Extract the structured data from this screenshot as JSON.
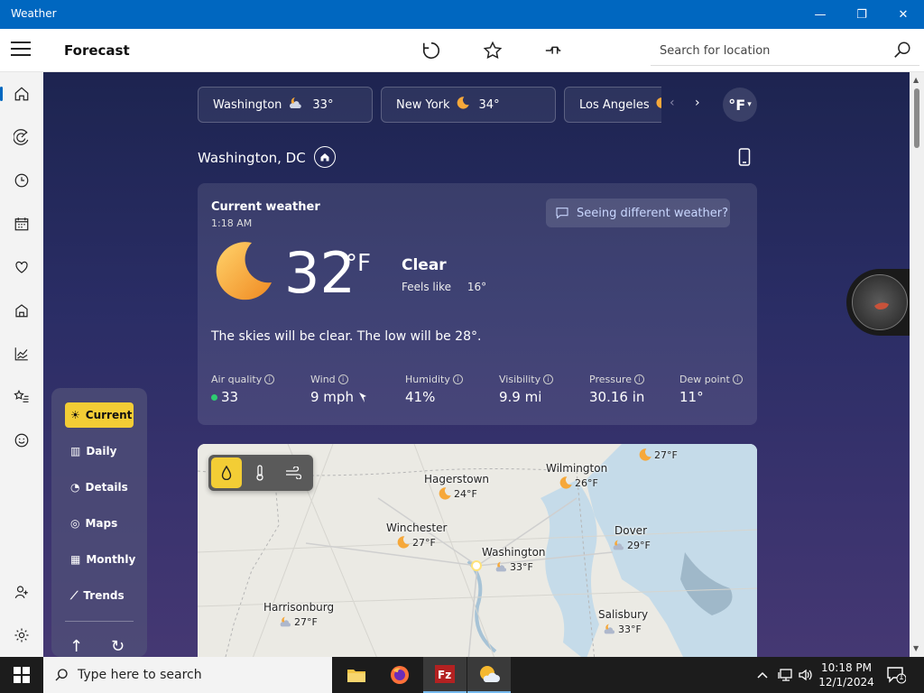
{
  "window": {
    "title": "Weather",
    "minimize": "—",
    "maximize": "❐",
    "close": "✕"
  },
  "header": {
    "page_title": "Forecast",
    "search_placeholder": "Search for location"
  },
  "locations": [
    {
      "name": "Washington",
      "temp": "33°"
    },
    {
      "name": "New York",
      "temp": "34°"
    },
    {
      "name": "Los Angeles",
      "temp": ""
    }
  ],
  "unit_toggle": "°F",
  "city": "Washington, DC",
  "current": {
    "title": "Current weather",
    "time": "1:18 AM",
    "feedback": "Seeing different weather?",
    "temp": "32",
    "unit": "°F",
    "condition": "Clear",
    "feels_label": "Feels like",
    "feels_value": "16°",
    "summary": "The skies will be clear. The low will be 28°.",
    "stats": [
      {
        "label": "Air quality",
        "value": "33"
      },
      {
        "label": "Wind",
        "value": "9 mph"
      },
      {
        "label": "Humidity",
        "value": "41%"
      },
      {
        "label": "Visibility",
        "value": "9.9 mi"
      },
      {
        "label": "Pressure",
        "value": "30.16 in"
      },
      {
        "label": "Dew point",
        "value": "11°"
      }
    ]
  },
  "map": {
    "cities": [
      {
        "name": "Hagerstown",
        "temp": "24°F"
      },
      {
        "name": "Wilmington",
        "temp": "26°F"
      },
      {
        "name": "Winchester",
        "temp": "27°F"
      },
      {
        "name": "Washington",
        "temp": "33°F"
      },
      {
        "name": "Dover",
        "temp": "29°F"
      },
      {
        "name": "Harrisonburg",
        "temp": "27°F"
      },
      {
        "name": "Salisbury",
        "temp": "33°F"
      },
      {
        "name": "",
        "temp": "27°F"
      }
    ]
  },
  "section_nav": [
    "Current",
    "Daily",
    "Details",
    "Maps",
    "Monthly",
    "Trends"
  ],
  "taskbar": {
    "search_placeholder": "Type here to search",
    "time": "10:18 PM",
    "date": "12/1/2024",
    "notifications": "1"
  }
}
